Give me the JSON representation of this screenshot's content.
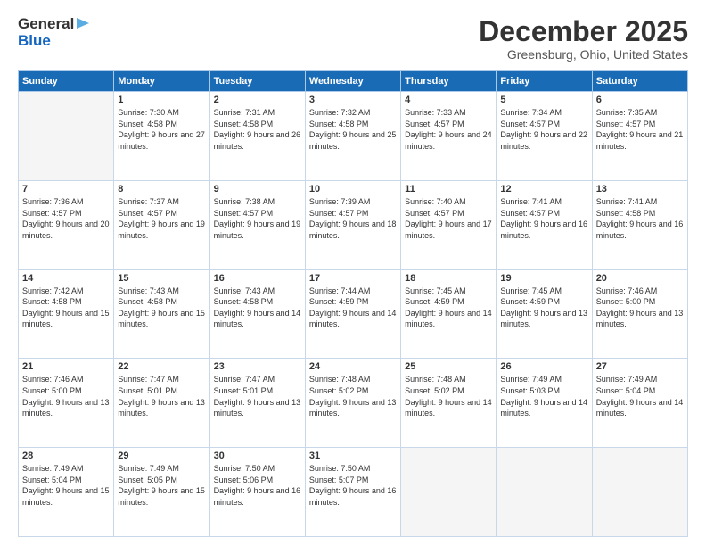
{
  "header": {
    "logo": {
      "general": "General",
      "blue": "Blue",
      "arrow": "►"
    },
    "title": "December 2025",
    "subtitle": "Greensburg, Ohio, United States"
  },
  "weekdays": [
    "Sunday",
    "Monday",
    "Tuesday",
    "Wednesday",
    "Thursday",
    "Friday",
    "Saturday"
  ],
  "weeks": [
    [
      {
        "day": "",
        "sunrise": "",
        "sunset": "",
        "daylight": ""
      },
      {
        "day": "1",
        "sunrise": "Sunrise: 7:30 AM",
        "sunset": "Sunset: 4:58 PM",
        "daylight": "Daylight: 9 hours and 27 minutes."
      },
      {
        "day": "2",
        "sunrise": "Sunrise: 7:31 AM",
        "sunset": "Sunset: 4:58 PM",
        "daylight": "Daylight: 9 hours and 26 minutes."
      },
      {
        "day": "3",
        "sunrise": "Sunrise: 7:32 AM",
        "sunset": "Sunset: 4:58 PM",
        "daylight": "Daylight: 9 hours and 25 minutes."
      },
      {
        "day": "4",
        "sunrise": "Sunrise: 7:33 AM",
        "sunset": "Sunset: 4:57 PM",
        "daylight": "Daylight: 9 hours and 24 minutes."
      },
      {
        "day": "5",
        "sunrise": "Sunrise: 7:34 AM",
        "sunset": "Sunset: 4:57 PM",
        "daylight": "Daylight: 9 hours and 22 minutes."
      },
      {
        "day": "6",
        "sunrise": "Sunrise: 7:35 AM",
        "sunset": "Sunset: 4:57 PM",
        "daylight": "Daylight: 9 hours and 21 minutes."
      }
    ],
    [
      {
        "day": "7",
        "sunrise": "Sunrise: 7:36 AM",
        "sunset": "Sunset: 4:57 PM",
        "daylight": "Daylight: 9 hours and 20 minutes."
      },
      {
        "day": "8",
        "sunrise": "Sunrise: 7:37 AM",
        "sunset": "Sunset: 4:57 PM",
        "daylight": "Daylight: 9 hours and 19 minutes."
      },
      {
        "day": "9",
        "sunrise": "Sunrise: 7:38 AM",
        "sunset": "Sunset: 4:57 PM",
        "daylight": "Daylight: 9 hours and 19 minutes."
      },
      {
        "day": "10",
        "sunrise": "Sunrise: 7:39 AM",
        "sunset": "Sunset: 4:57 PM",
        "daylight": "Daylight: 9 hours and 18 minutes."
      },
      {
        "day": "11",
        "sunrise": "Sunrise: 7:40 AM",
        "sunset": "Sunset: 4:57 PM",
        "daylight": "Daylight: 9 hours and 17 minutes."
      },
      {
        "day": "12",
        "sunrise": "Sunrise: 7:41 AM",
        "sunset": "Sunset: 4:57 PM",
        "daylight": "Daylight: 9 hours and 16 minutes."
      },
      {
        "day": "13",
        "sunrise": "Sunrise: 7:41 AM",
        "sunset": "Sunset: 4:58 PM",
        "daylight": "Daylight: 9 hours and 16 minutes."
      }
    ],
    [
      {
        "day": "14",
        "sunrise": "Sunrise: 7:42 AM",
        "sunset": "Sunset: 4:58 PM",
        "daylight": "Daylight: 9 hours and 15 minutes."
      },
      {
        "day": "15",
        "sunrise": "Sunrise: 7:43 AM",
        "sunset": "Sunset: 4:58 PM",
        "daylight": "Daylight: 9 hours and 15 minutes."
      },
      {
        "day": "16",
        "sunrise": "Sunrise: 7:43 AM",
        "sunset": "Sunset: 4:58 PM",
        "daylight": "Daylight: 9 hours and 14 minutes."
      },
      {
        "day": "17",
        "sunrise": "Sunrise: 7:44 AM",
        "sunset": "Sunset: 4:59 PM",
        "daylight": "Daylight: 9 hours and 14 minutes."
      },
      {
        "day": "18",
        "sunrise": "Sunrise: 7:45 AM",
        "sunset": "Sunset: 4:59 PM",
        "daylight": "Daylight: 9 hours and 14 minutes."
      },
      {
        "day": "19",
        "sunrise": "Sunrise: 7:45 AM",
        "sunset": "Sunset: 4:59 PM",
        "daylight": "Daylight: 9 hours and 13 minutes."
      },
      {
        "day": "20",
        "sunrise": "Sunrise: 7:46 AM",
        "sunset": "Sunset: 5:00 PM",
        "daylight": "Daylight: 9 hours and 13 minutes."
      }
    ],
    [
      {
        "day": "21",
        "sunrise": "Sunrise: 7:46 AM",
        "sunset": "Sunset: 5:00 PM",
        "daylight": "Daylight: 9 hours and 13 minutes."
      },
      {
        "day": "22",
        "sunrise": "Sunrise: 7:47 AM",
        "sunset": "Sunset: 5:01 PM",
        "daylight": "Daylight: 9 hours and 13 minutes."
      },
      {
        "day": "23",
        "sunrise": "Sunrise: 7:47 AM",
        "sunset": "Sunset: 5:01 PM",
        "daylight": "Daylight: 9 hours and 13 minutes."
      },
      {
        "day": "24",
        "sunrise": "Sunrise: 7:48 AM",
        "sunset": "Sunset: 5:02 PM",
        "daylight": "Daylight: 9 hours and 13 minutes."
      },
      {
        "day": "25",
        "sunrise": "Sunrise: 7:48 AM",
        "sunset": "Sunset: 5:02 PM",
        "daylight": "Daylight: 9 hours and 14 minutes."
      },
      {
        "day": "26",
        "sunrise": "Sunrise: 7:49 AM",
        "sunset": "Sunset: 5:03 PM",
        "daylight": "Daylight: 9 hours and 14 minutes."
      },
      {
        "day": "27",
        "sunrise": "Sunrise: 7:49 AM",
        "sunset": "Sunset: 5:04 PM",
        "daylight": "Daylight: 9 hours and 14 minutes."
      }
    ],
    [
      {
        "day": "28",
        "sunrise": "Sunrise: 7:49 AM",
        "sunset": "Sunset: 5:04 PM",
        "daylight": "Daylight: 9 hours and 15 minutes."
      },
      {
        "day": "29",
        "sunrise": "Sunrise: 7:49 AM",
        "sunset": "Sunset: 5:05 PM",
        "daylight": "Daylight: 9 hours and 15 minutes."
      },
      {
        "day": "30",
        "sunrise": "Sunrise: 7:50 AM",
        "sunset": "Sunset: 5:06 PM",
        "daylight": "Daylight: 9 hours and 16 minutes."
      },
      {
        "day": "31",
        "sunrise": "Sunrise: 7:50 AM",
        "sunset": "Sunset: 5:07 PM",
        "daylight": "Daylight: 9 hours and 16 minutes."
      },
      {
        "day": "",
        "sunrise": "",
        "sunset": "",
        "daylight": ""
      },
      {
        "day": "",
        "sunrise": "",
        "sunset": "",
        "daylight": ""
      },
      {
        "day": "",
        "sunrise": "",
        "sunset": "",
        "daylight": ""
      }
    ]
  ]
}
